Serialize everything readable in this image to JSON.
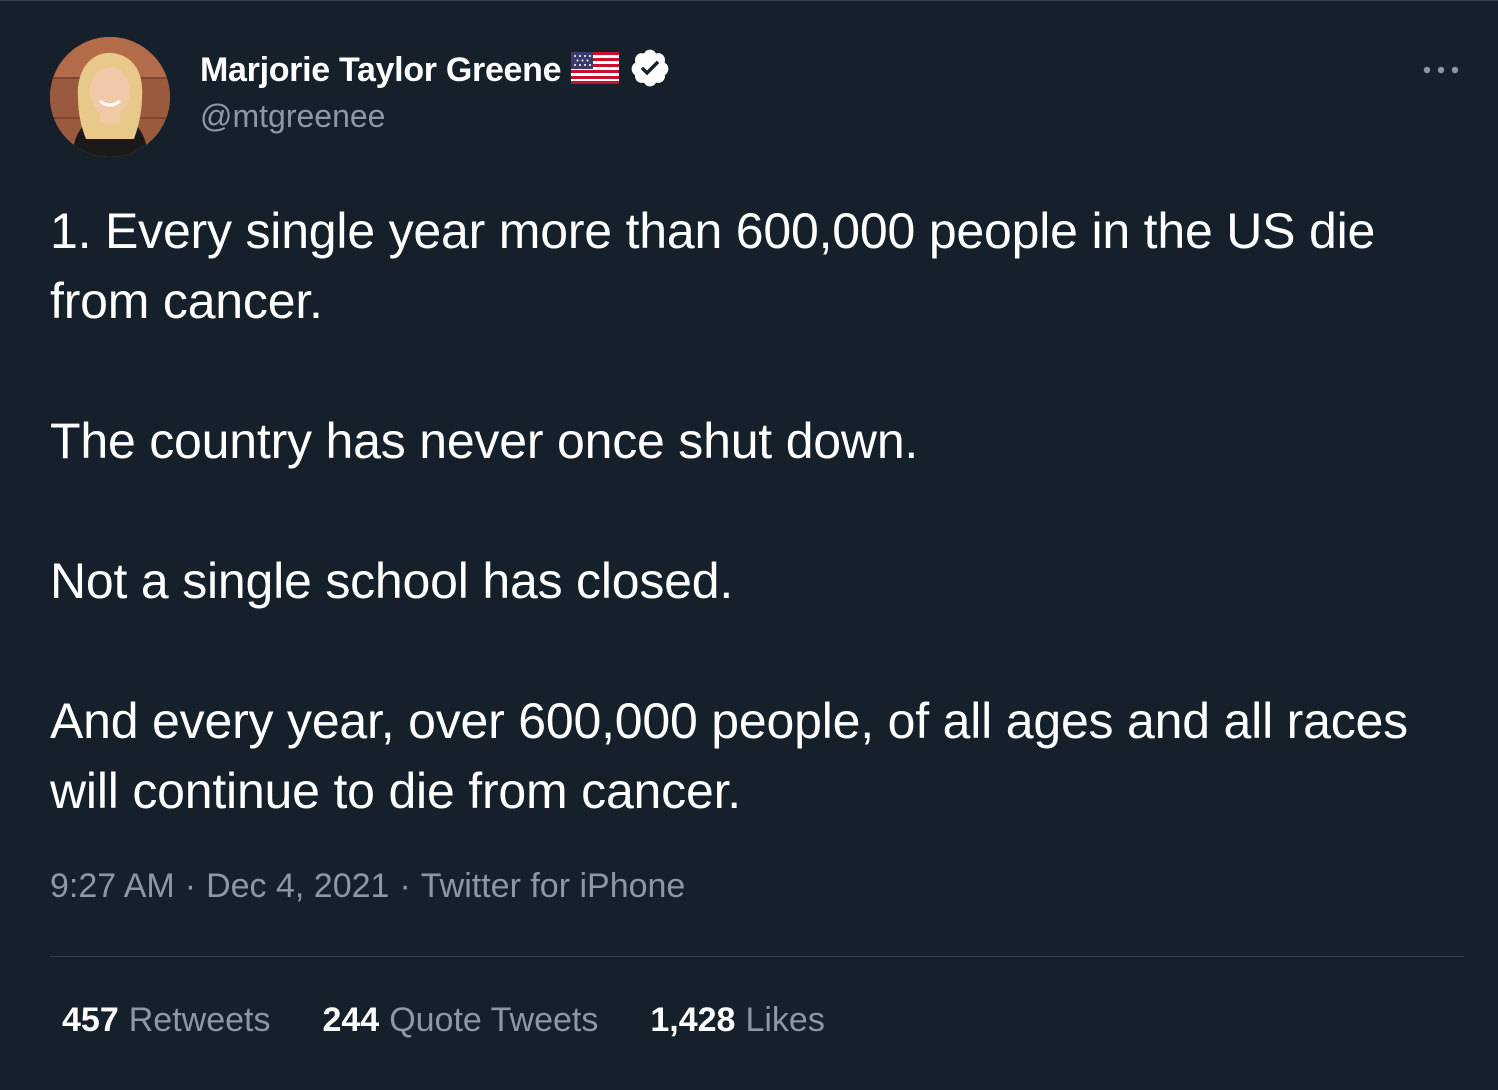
{
  "author": {
    "name": "Marjorie Taylor Greene",
    "handle": "@mtgreenee",
    "flag_icon": "us-flag-icon",
    "verified_icon": "verified-badge-icon"
  },
  "tweet": {
    "paragraphs": [
      "1. Every single year more than 600,000 people in the US die from cancer.",
      "The country has never once shut down.",
      "Not a single school has closed.",
      "And every year, over 600,000 people, of all ages and all races will continue to die from cancer."
    ]
  },
  "meta": {
    "time": "9:27 AM",
    "separator": "·",
    "date": "Dec 4, 2021",
    "source": "Twitter for iPhone"
  },
  "stats": {
    "retweets_count": "457",
    "retweets_label": "Retweets",
    "quote_count": "244",
    "quote_label": "Quote Tweets",
    "likes_count": "1,428",
    "likes_label": "Likes"
  },
  "colors": {
    "background": "#15202b",
    "text_primary": "#ffffff",
    "text_secondary": "#8b98a5",
    "divider": "#38444d",
    "verified_badge": "#ffffff"
  }
}
